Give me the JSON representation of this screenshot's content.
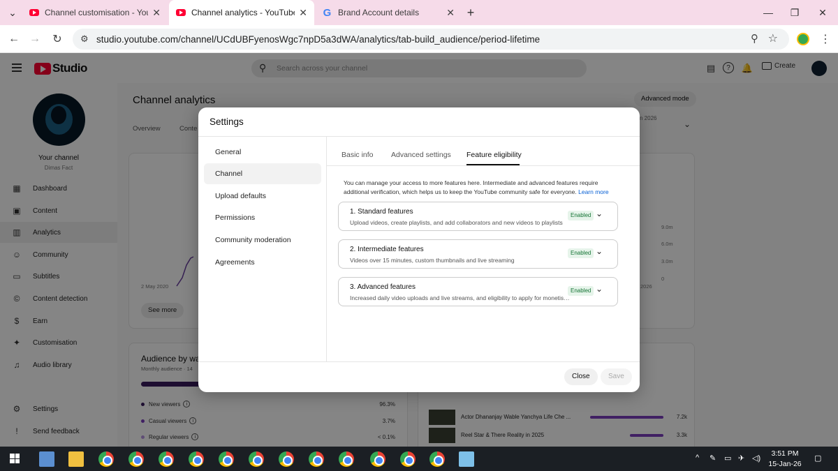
{
  "browser": {
    "tabs": [
      {
        "label": "Channel customisation - YouTube Studio"
      },
      {
        "label": "Channel analytics - YouTube Studio"
      },
      {
        "label": "Brand Account details"
      }
    ],
    "url": "studio.youtube.com/channel/UCdUBFyenosWgc7npD5a3dWA/analytics/tab-build_audience/period-lifetime"
  },
  "studio": {
    "logo_text": "Studio",
    "search_placeholder": "Search across your channel",
    "create_label": "Create",
    "channel_label": "Your channel",
    "channel_name": "Dimas Fact",
    "nav": [
      {
        "label": "Dashboard",
        "icon": "dashboard-icon"
      },
      {
        "label": "Content",
        "icon": "content-icon"
      },
      {
        "label": "Analytics",
        "icon": "analytics-icon"
      },
      {
        "label": "Community",
        "icon": "community-icon"
      },
      {
        "label": "Subtitles",
        "icon": "subtitles-icon"
      },
      {
        "label": "Content detection",
        "icon": "copyright-icon"
      },
      {
        "label": "Earn",
        "icon": "dollar-icon"
      },
      {
        "label": "Customisation",
        "icon": "wand-icon"
      },
      {
        "label": "Audio library",
        "icon": "audio-library-icon"
      }
    ],
    "settings_label": "Settings",
    "feedback_label": "Send feedback"
  },
  "analytics": {
    "title": "Channel analytics",
    "advanced_mode": "Advanced mode",
    "tabs": [
      "Overview",
      "Conte"
    ],
    "date_fragment": "n 2026",
    "chart_start_date": "2 May 2020",
    "chart_end_fragment": "2026",
    "y_ticks": [
      "9.0m",
      "6.0m",
      "3.0m",
      "0"
    ],
    "see_more": "See more",
    "audience_title": "Audience by wa",
    "audience_sub": "Monthly audience · 14",
    "legend": [
      {
        "label": "New viewers",
        "pct": "96.3%"
      },
      {
        "label": "Casual viewers",
        "pct": "3.7%"
      },
      {
        "label": "Regular viewers",
        "pct": "< 0.1%"
      }
    ],
    "videos": [
      {
        "title": "Actor Dhananjay Wable Yanchya Life Che ...",
        "views": "7.2k"
      },
      {
        "title": "Reel Star & There Reality in 2025",
        "views": "3.3k"
      }
    ]
  },
  "dialog": {
    "title": "Settings",
    "nav": [
      "General",
      "Channel",
      "Upload defaults",
      "Permissions",
      "Community moderation",
      "Agreements"
    ],
    "tabs": [
      "Basic info",
      "Advanced settings",
      "Feature eligibility"
    ],
    "intro": "You can manage your access to more features here. Intermediate and advanced features require additional verification, which helps us to keep the YouTube community safe for everyone.",
    "learn_more": "Learn more",
    "features": [
      {
        "title": "1. Standard features",
        "desc": "Upload videos, create playlists, and add collaborators and new videos to playlists",
        "status": "Enabled"
      },
      {
        "title": "2. Intermediate features",
        "desc": "Videos over 15 minutes, custom thumbnails and live streaming",
        "status": "Enabled"
      },
      {
        "title": "3. Advanced features",
        "desc": "Increased daily video uploads and live streams, and eligibility to apply for monetisation",
        "status": "Enabled"
      }
    ],
    "close_label": "Close",
    "save_label": "Save"
  },
  "taskbar": {
    "time": "3:51 PM",
    "date": "15-Jan-26"
  }
}
